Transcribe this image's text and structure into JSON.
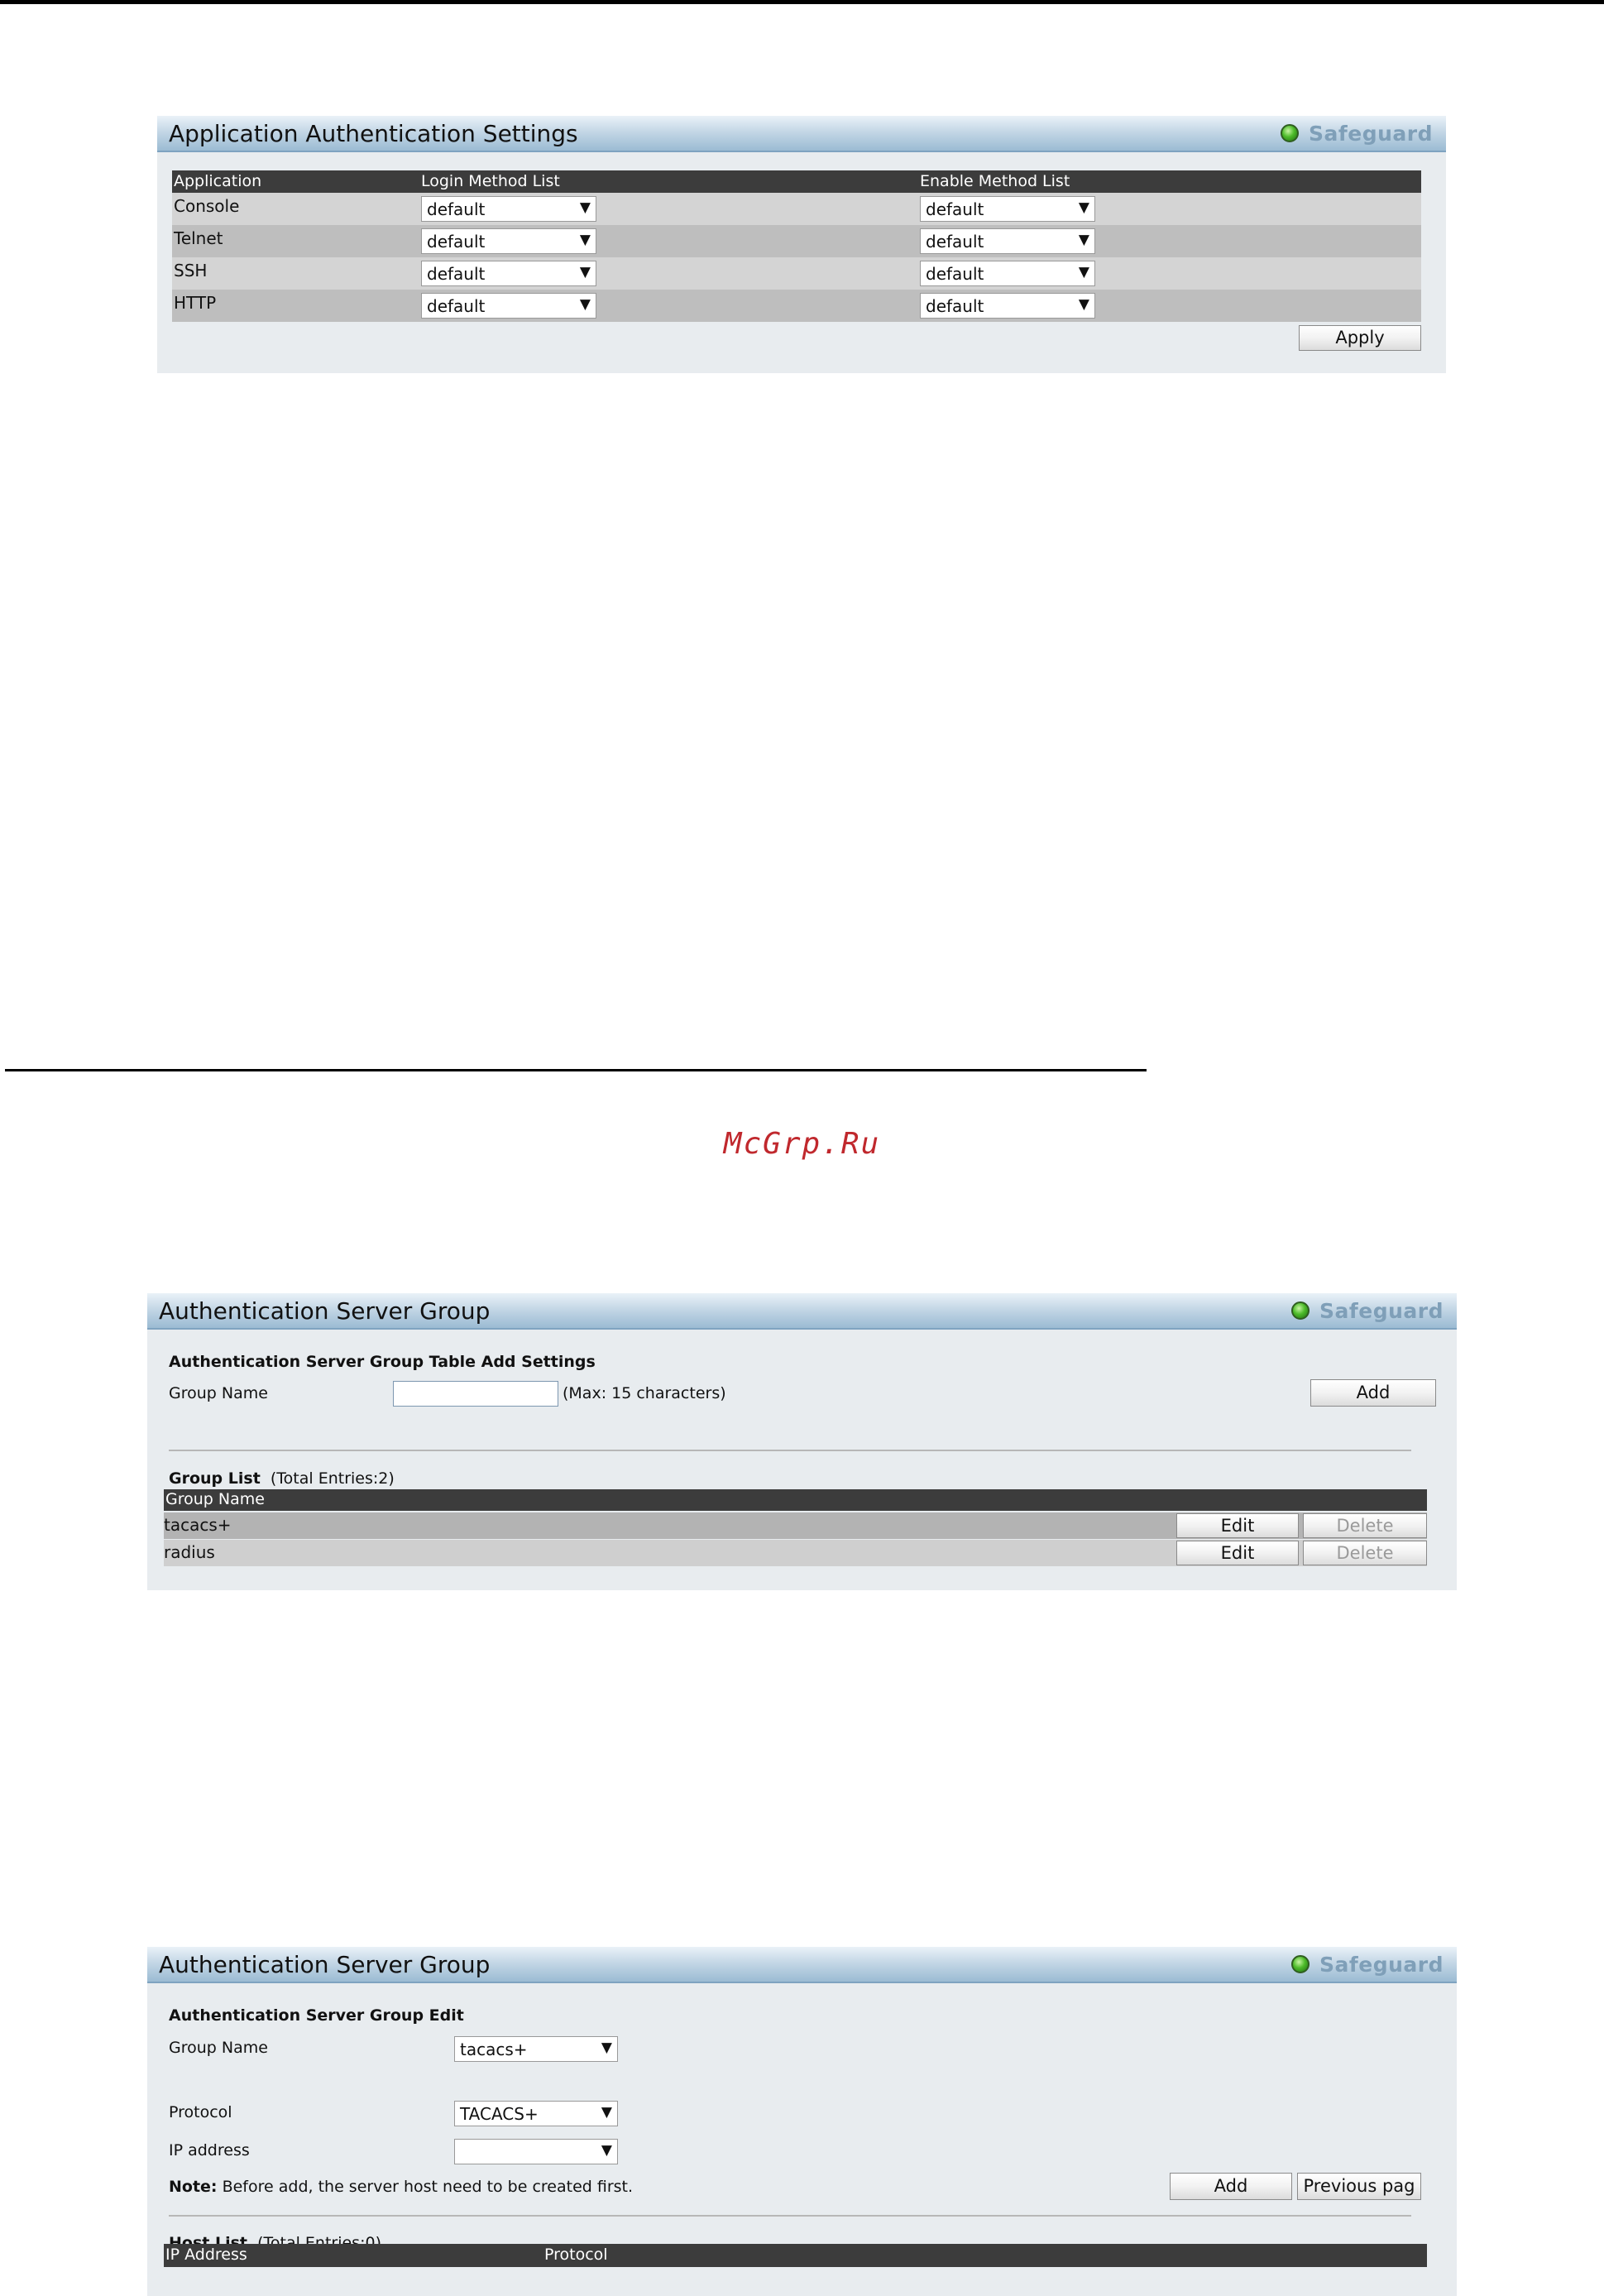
{
  "watermark": "McGrp.Ru",
  "panel1": {
    "title": "Application Authentication Settings",
    "badge": "Safeguard",
    "columns": [
      "Application",
      "Login Method List",
      "Enable Method List"
    ],
    "rows": [
      {
        "app": "Console",
        "login": "default",
        "enable": "default"
      },
      {
        "app": "Telnet",
        "login": "default",
        "enable": "default"
      },
      {
        "app": "SSH",
        "login": "default",
        "enable": "default"
      },
      {
        "app": "HTTP",
        "login": "default",
        "enable": "default"
      }
    ],
    "apply_label": "Apply"
  },
  "panel2": {
    "title": "Authentication Server Group",
    "badge": "Safeguard",
    "section_title": "Authentication Server Group Table Add Settings",
    "group_name_label": "Group Name",
    "group_name_value": "",
    "hint": "(Max: 15 characters)",
    "add_label": "Add",
    "list_title": "Group List",
    "list_count": "(Total Entries:2)",
    "list_column": "Group Name",
    "groups": [
      {
        "name": "tacacs+",
        "edit": "Edit",
        "delete": "Delete"
      },
      {
        "name": "radius",
        "edit": "Edit",
        "delete": "Delete"
      }
    ]
  },
  "panel3": {
    "title": "Authentication Server Group",
    "badge": "Safeguard",
    "section_title": "Authentication Server Group Edit",
    "group_name_label": "Group Name",
    "group_name_value": "tacacs+",
    "protocol_label": "Protocol",
    "protocol_value": "TACACS+",
    "ip_label": "IP address",
    "ip_value": "",
    "note_bold": "Note:",
    "note_text": "Before add, the server host need to be created first.",
    "add_label": "Add",
    "prev_label": "Previous pag",
    "host_list_title": "Host List",
    "host_list_count": "(Total Entries:0)",
    "host_columns": [
      "IP Address",
      "Protocol"
    ]
  }
}
